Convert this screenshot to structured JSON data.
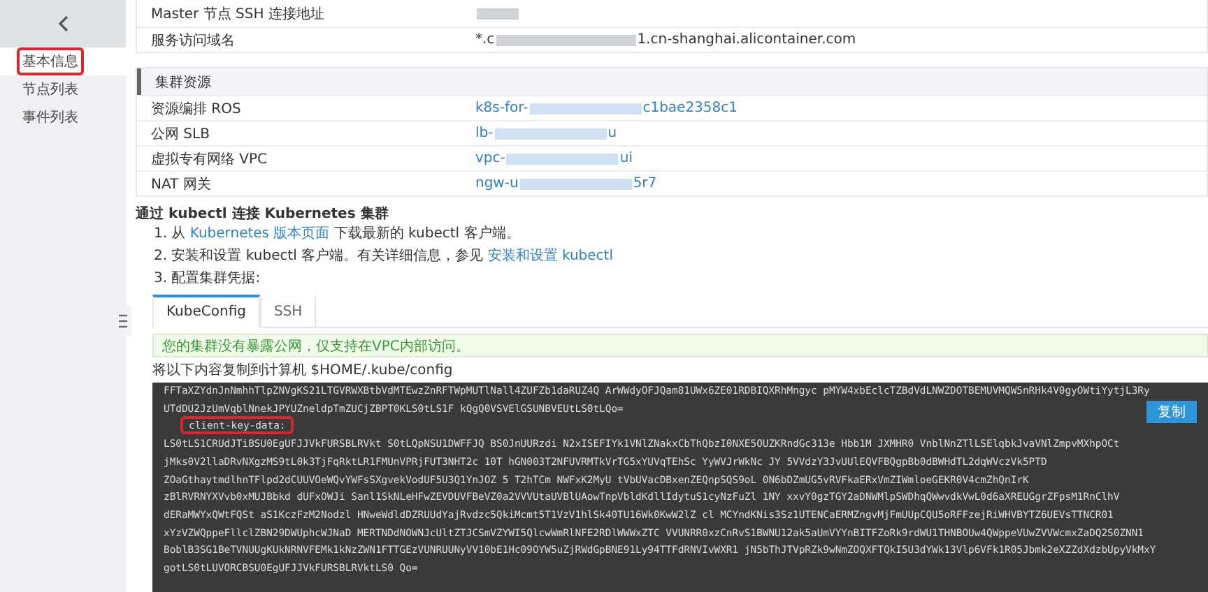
{
  "sidebar": {
    "items": [
      {
        "label": "基本信息",
        "selected": true,
        "highlighted": true
      },
      {
        "label": "节点列表",
        "selected": false,
        "highlighted": false
      },
      {
        "label": "事件列表",
        "selected": false,
        "highlighted": false
      }
    ]
  },
  "info_rows": [
    {
      "label": "Master 节点 SSH 连接地址",
      "redacted": true,
      "value_parts": []
    },
    {
      "label": "服务访问域名",
      "redacted": true,
      "value_parts": [
        "*.c",
        "1.cn-shanghai.alicontainer.com"
      ]
    }
  ],
  "resources": {
    "title": "集群资源",
    "rows": [
      {
        "label": "资源编排 ROS",
        "value_parts": [
          "k8s-for-",
          "c1bae2358c1"
        ]
      },
      {
        "label": "公网 SLB",
        "value_parts": [
          "lb-",
          "u"
        ]
      },
      {
        "label": "虚拟专有网络 VPC",
        "value_parts": [
          "vpc-",
          "ui"
        ]
      },
      {
        "label": "NAT 网关",
        "value_parts": [
          "ngw-u",
          "5r7"
        ]
      }
    ]
  },
  "kubectl": {
    "heading": "通过 kubectl 连接 Kubernetes 集群",
    "steps": [
      [
        {
          "text": "1. 从 ",
          "link": false
        },
        {
          "text": "Kubernetes 版本页面",
          "link": true
        },
        {
          "text": " 下载最新的 kubectl 客户端。",
          "link": false
        }
      ],
      [
        {
          "text": "2. 安装和设置 kubectl 客户端。有关详细信息，参见 ",
          "link": false
        },
        {
          "text": "安装和设置 kubectl",
          "link": true
        }
      ],
      [
        {
          "text": "3. 配置集群凭据:",
          "link": false
        }
      ]
    ],
    "tabs": [
      {
        "label": "KubeConfig",
        "selected": true
      },
      {
        "label": "SSH",
        "selected": false
      }
    ],
    "notice": "您的集群没有暴露公网，仅支持在VPC内部访问。",
    "instruction": "将以下内容复制到计算机 $HOME/.kube/config",
    "copy_button": "复制",
    "code_lines": [
      {
        "text": "FFTaXZYdnJnNmhhTlpZNVgKS21LTGVRWXBtbVdMTEwzZnRFTWpMUTlNall4ZUFZb1daRUZ4Q ArWWdyOFJQam81UWx6ZE01RDBIQXRhMngyc pMYW4xbEclcTZBdVdLNWZDOTBEMUVMQW5nRHk4V0gyOWtiYytjL3Ry",
        "highlighted": false
      },
      {
        "text": "UTdDU2JzUmVqblNnekJPYUZneldpTmZUCjZBPT0KLS0tLS1F kQgQ0VSVElGSUNBVEUtLS0tLQo=",
        "highlighted": false
      },
      {
        "text": "client-key-data:",
        "highlighted": true
      },
      {
        "text": "LS0tLS1CRUdJTiBSU0EgUFJJVkFURSBLRVkt S0tLQpNSU1DWFFJQ BS0JnUURzdi N2xISEFIYk1VNlZNakxCbThQbzI0NXE5OUZKRndGc313e Hbb1M JXMHR0 VnblNnZTlLSElqbkJvaVNlZmpvMXhpOCt",
        "highlighted": false
      },
      {
        "text": "jMks0V2llaDRvNXgzMS9tL0k3TjFqRktLR1FMUnVPRjFUT3NHT2c 10T hGN003T2NFUVRMTkVrTG5xYUVqTEhSc YyWVJrWkNc JY 5VVdzY3JvUUlEQVFBQgpBb0dBWHdTL2dqWVczVk5PTD",
        "highlighted": false
      },
      {
        "text": "ZOaGthaytmdlhnTFlpd2dCUUVOeWQvYWFsSXgvekVodUF5U3Q1YnJOZ 5 T2hTCm NWFxK2MyU tVbUVacDBxenZEQnpSQS9oL 0N6bDZmUG5vRVFkaERxVmZIWmloeGEKR0V4cmZhQnIrK",
        "highlighted": false
      },
      {
        "text": "zBlRVRNYXVvb0xMUJBbkd dUFxOWJi Sanl1SkNLeHFwZEVDUVFBeVZ0a2VVVUtaUVBlUAowTnpVbldKdllIdytuS1cyNzFuZl 1NY xxvY0gzTGY2aDNWMlpSWDhqQWwvdkVwL0d6aXREUGgrZFpsM1RnClhV",
        "highlighted": false
      },
      {
        "text": "dERaMWYxQWtFQSt aS1KczFzM2Nodzl HNweWdldDZRUUdYajRvdzc5QkiMcmt5T1VzV1hlSk40TU16Wk0KwW2lZ cl MCYndKNis3Sz1UTENCaERMZngvMjFmUUpCQU5oRFFzejRiWHVBYTZ6UEVsTTNCR01",
        "highlighted": false
      },
      {
        "text": "xYzVZWQppeFllclZBN29DWUphcWJNaD MERTNDdNOWNJcUltZTJCSmVZYWI5QlcwWmRlNFE2RDlWWWxZTC VVUNRR0xzCnRvS1BWNU12ak5aUmVYYnBITFZoRk9rdWU1THNBOUw4QWppeVUwZVVWcmxZaDQ2S0ZNN1",
        "highlighted": false
      },
      {
        "text": "BoblB3SG1BeTVNUUgKUkNRNVFEMk1kNzZWN1FTTGEzVUNRUUNyVV10bE1Hc09OYW5uZjRWdGpBNE91Ly94TTFdRNVIvWXR1 jN5bThJTVpRZk9wNmZOQXFTQkI5U3dYWk13Vlp6VFk1R05Jbmk2eXZZdXdzbUpyVkMxY",
        "highlighted": false
      },
      {
        "text": "gotLS0tLUVORCBSU0EgUFJJVkFURSBLRVktLS0 Qo=",
        "highlighted": false
      }
    ]
  }
}
